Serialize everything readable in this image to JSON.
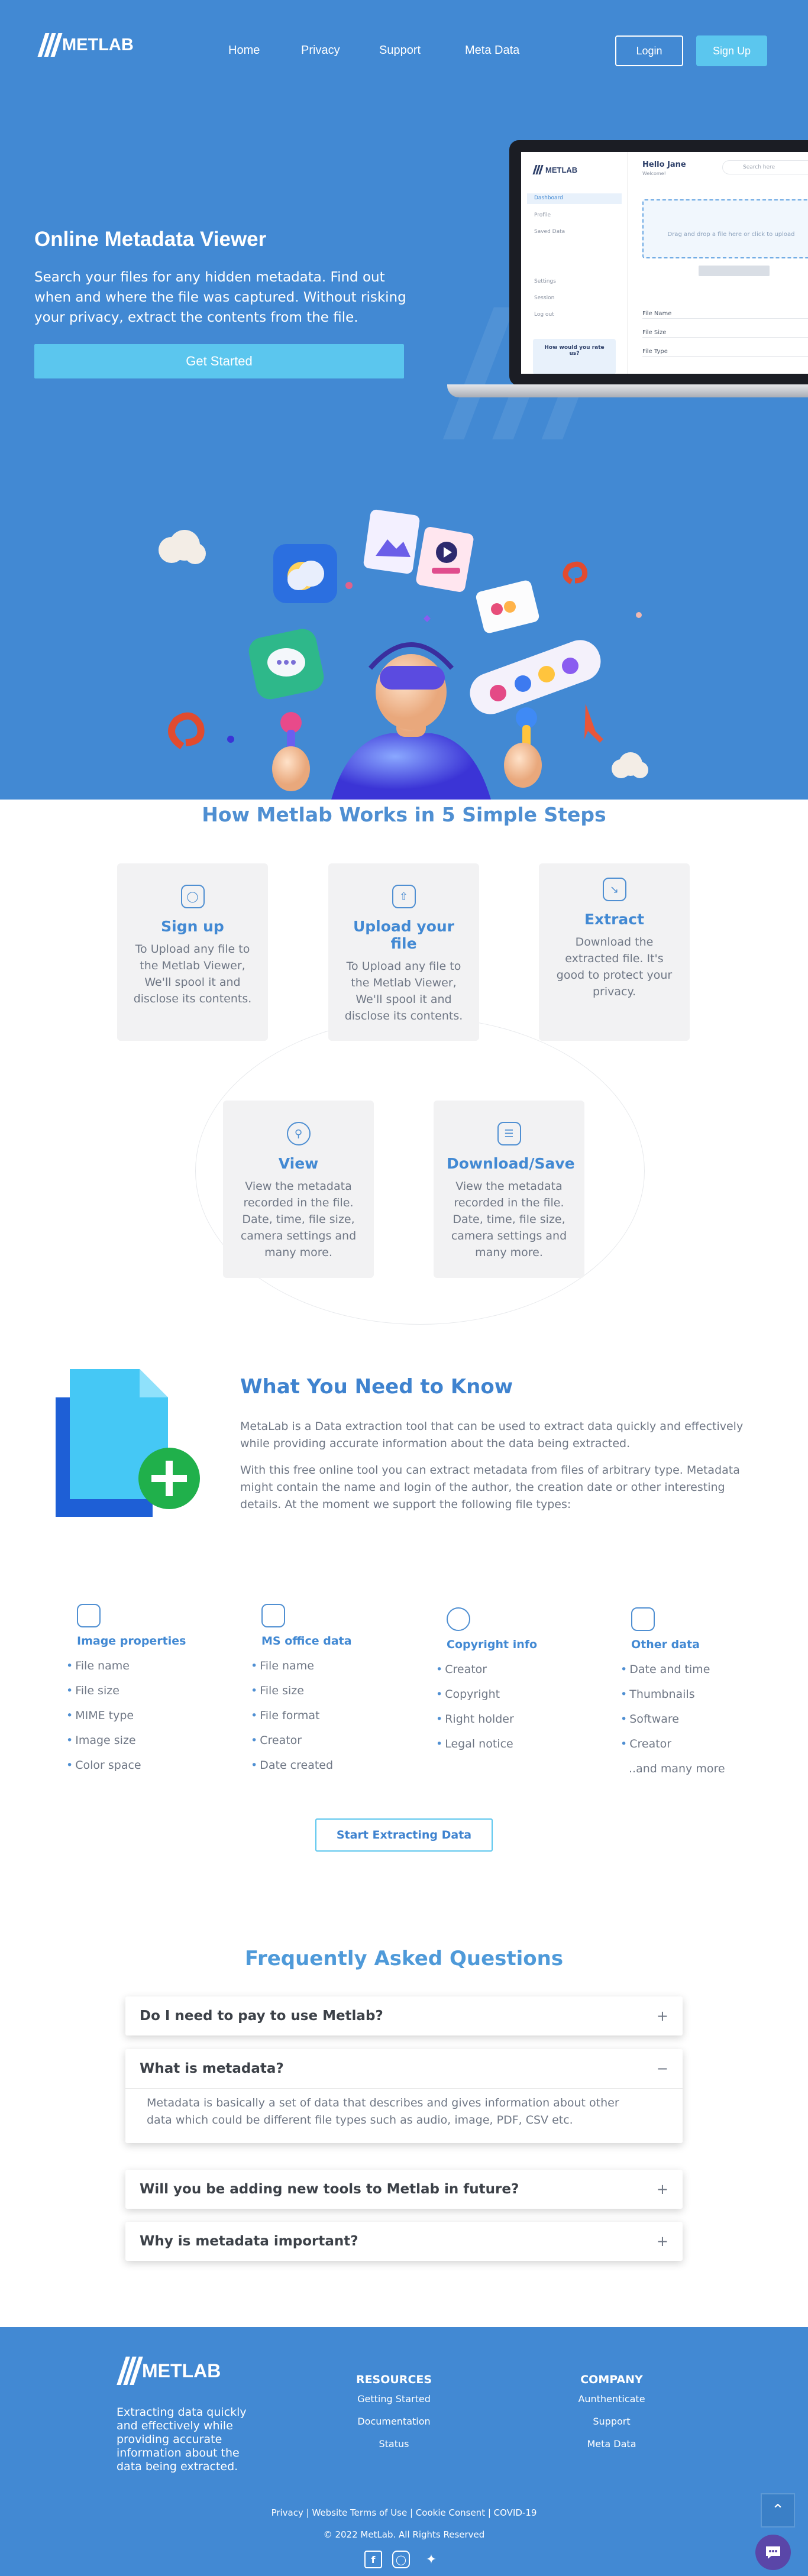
{
  "nav": {
    "brand_bold": "METLAB",
    "brand_light": "",
    "links": [
      "Home",
      "Privacy",
      "Support",
      "Meta Data"
    ],
    "login": "Login",
    "signup": "Sign Up"
  },
  "hero": {
    "title": "Online Metadata Viewer",
    "text": "Search your files for any hidden metadata. Find out when and where the file was captured. Without risking your privacy, extract the contents from the file.",
    "cta": "Get Started"
  },
  "laptop": {
    "greeting": "Hello Jane",
    "subtitle": "Welcome!",
    "search_placeholder": "Search here",
    "menu": [
      "Dashboard",
      "Profile",
      "Saved Data",
      "Settings",
      "Session",
      "Log out"
    ],
    "drop_text": "Drag and drop a file here or click to upload",
    "fields": [
      "File Name",
      "File Size",
      "File Type"
    ],
    "promo": "How would you rate us?"
  },
  "steps": {
    "title": "How Metlab Works in 5 Simple Steps",
    "items": [
      {
        "title": "Sign up",
        "text": "To Upload any file to the Metlab Viewer, We'll spool it and disclose its contents."
      },
      {
        "title": "Upload your file",
        "text": "To Upload any file to the Metlab Viewer, We'll spool it and disclose its contents."
      },
      {
        "title": "Extract",
        "text": "Download the extracted file. It's good to protect your privacy."
      },
      {
        "title": "View",
        "text": "View the metadata recorded in the file. Date, time, file size, camera settings and many more."
      },
      {
        "title": "Download/Save",
        "text": "View the metadata recorded in the file. Date, time, file size, camera settings and many more."
      }
    ]
  },
  "know": {
    "title": "What You Need to Know",
    "p1": "MetaLab is a Data extraction tool that can be used to extract data quickly and effectively while providing accurate information about the data being extracted.",
    "p2": "With this free online tool you can extract metadata from files of arbitrary type. Metadata might contain the name and login of the author, the creation date or other interesting details. At the moment we support the following file types:"
  },
  "filetypes": [
    {
      "title": "Image properties",
      "icon": "image-icon",
      "items": [
        "File name",
        "File size",
        "MIME type",
        "Image size",
        "Color space"
      ]
    },
    {
      "title": "MS office data",
      "icon": "document-icon",
      "items": [
        "File name",
        "File size",
        "File format",
        "Creator",
        "Date created"
      ]
    },
    {
      "title": "Copyright info",
      "icon": "user-check-icon",
      "items": [
        "Creator",
        "Copyright",
        "Right holder",
        "Legal notice"
      ]
    },
    {
      "title": "Other data",
      "icon": "apps-icon",
      "items": [
        "Date and time",
        "Thumbnails",
        "Software",
        "Creator"
      ],
      "more": "..and many more"
    }
  ],
  "extract_button": "Start Extracting Data",
  "faq": {
    "title": "Frequently Asked Questions",
    "items": [
      {
        "q": "Do I need to pay to use Metlab?",
        "sign": "+"
      },
      {
        "q": "What is metadata?",
        "sign": "−",
        "a": "Metadata is basically a set of data that describes and gives information about other data which could be different file types such as audio, image, PDF, CSV etc."
      },
      {
        "q": "Will you be adding new tools to Metlab in future?",
        "sign": "+"
      },
      {
        "q": "Why is metadata important?",
        "sign": "+"
      }
    ]
  },
  "footer": {
    "description": "Extracting data quickly and effectively while providing accurate information about the data being extracted.",
    "resources_title": "RESOURCES",
    "resources": [
      "Getting Started",
      "Documentation",
      "Status"
    ],
    "company_title": "COMPANY",
    "company": [
      "Aunthenticate",
      "Support",
      "Meta Data"
    ],
    "legal": "Privacy | Website Terms of Use | Cookie Consent | COVID-19",
    "copyright": "© 2022 MetLab. All Rights Reserved"
  },
  "colors": {
    "primary": "#4289d3",
    "accent": "#5bc6ee",
    "heading": "#3f83cf"
  }
}
